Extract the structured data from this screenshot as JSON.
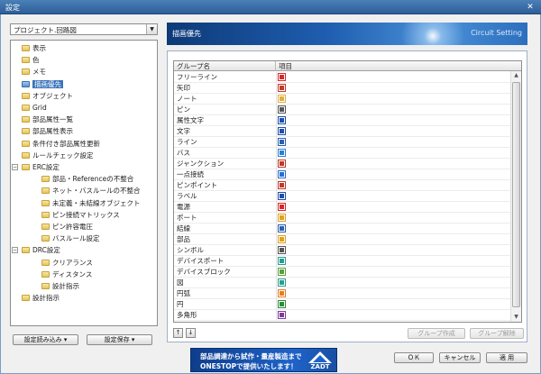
{
  "window": {
    "title": "設定",
    "close": "✕"
  },
  "combo": {
    "value": "プロジェクト.回路図"
  },
  "tree": [
    {
      "label": "表示",
      "indent": 0
    },
    {
      "label": "色",
      "indent": 0
    },
    {
      "label": "メモ",
      "indent": 0
    },
    {
      "label": "描画優先",
      "indent": 0,
      "selected": true
    },
    {
      "label": "オブジェクト",
      "indent": 0
    },
    {
      "label": "Grid",
      "indent": 0
    },
    {
      "label": "部品属性一覧",
      "indent": 0
    },
    {
      "label": "部品属性表示",
      "indent": 0
    },
    {
      "label": "条件付き部品属性更新",
      "indent": 0
    },
    {
      "label": "ルールチェック設定",
      "indent": 0
    },
    {
      "label": "ERC設定",
      "indent": 0,
      "expander": "−"
    },
    {
      "label": "部品・Referenceの不整合",
      "indent": 1
    },
    {
      "label": "ネット・バスルールの不整合",
      "indent": 1
    },
    {
      "label": "未定義・未結線オブジェクト",
      "indent": 1
    },
    {
      "label": "ピン接続マトリックス",
      "indent": 1
    },
    {
      "label": "ピン許容電圧",
      "indent": 1
    },
    {
      "label": "バスルール設定",
      "indent": 1
    },
    {
      "label": "DRC設定",
      "indent": 0,
      "expander": "−"
    },
    {
      "label": "クリアランス",
      "indent": 1
    },
    {
      "label": "ディスタンス",
      "indent": 1
    },
    {
      "label": "設計指示",
      "indent": 1
    },
    {
      "label": "設計指示",
      "indent": 0
    }
  ],
  "left_buttons": {
    "load": "設定読み込み ▾",
    "save": "設定保存 ▾"
  },
  "header": {
    "title": "描画優先",
    "brand": "Circuit Setting"
  },
  "table": {
    "columns": [
      "グループ名",
      "項目"
    ],
    "rows": [
      {
        "name": "フリーライン",
        "icon": "spiral-icon",
        "color": "#d9262b"
      },
      {
        "name": "矢印",
        "icon": "arrow-icon",
        "color": "#c0392b"
      },
      {
        "name": "ノート",
        "icon": "note-icon",
        "color": "#e0b040"
      },
      {
        "name": "ピン",
        "icon": "pin-icon",
        "color": "#555555"
      },
      {
        "name": "属性文字",
        "icon": "attr-text-icon",
        "color": "#1f4fa8"
      },
      {
        "name": "文字",
        "icon": "text-icon",
        "color": "#1f4fa8"
      },
      {
        "name": "ライン",
        "icon": "line-icon",
        "color": "#2b5fb0"
      },
      {
        "name": "バス",
        "icon": "bus-icon",
        "color": "#2b7fd0"
      },
      {
        "name": "ジャンクション",
        "icon": "junction-icon",
        "color": "#c0392b"
      },
      {
        "name": "一点接続",
        "icon": "single-connect-icon",
        "color": "#2a6fd0"
      },
      {
        "name": "ピンポイント",
        "icon": "pinpoint-icon",
        "color": "#c0392b"
      },
      {
        "name": "ラベル",
        "icon": "label-icon",
        "color": "#1f4fa8"
      },
      {
        "name": "電源",
        "icon": "power-icon",
        "color": "#d9262b"
      },
      {
        "name": "ポート",
        "icon": "port-icon",
        "color": "#e0a020"
      },
      {
        "name": "結線",
        "icon": "wire-icon",
        "color": "#2b5fb0"
      },
      {
        "name": "部品",
        "icon": "component-icon",
        "color": "#e0a020"
      },
      {
        "name": "シンボル",
        "icon": "symbol-icon",
        "color": "#555555"
      },
      {
        "name": "デバイスポート",
        "icon": "device-port-icon",
        "color": "#2a9d8f"
      },
      {
        "name": "デバイスブロック",
        "icon": "device-block-icon",
        "color": "#5a9e3a"
      },
      {
        "name": "図",
        "icon": "figure-icon",
        "color": "#2a9d8f"
      },
      {
        "name": "円弧",
        "icon": "arc-icon",
        "color": "#e67e22"
      },
      {
        "name": "円",
        "icon": "circle-icon",
        "color": "#2e8b3a"
      },
      {
        "name": "多角形",
        "icon": "polygon-icon",
        "color": "#7d3c98"
      }
    ]
  },
  "group_buttons": {
    "create": "グループ作成",
    "release": "グループ解除"
  },
  "banner": {
    "line1": "部品調達から試作・量産製造まで",
    "line2": "ONESTOPで提供いたします！",
    "logo": "ZADT"
  },
  "footer": {
    "ok": "ＯＫ",
    "cancel": "キャンセル",
    "apply": "適 用"
  }
}
